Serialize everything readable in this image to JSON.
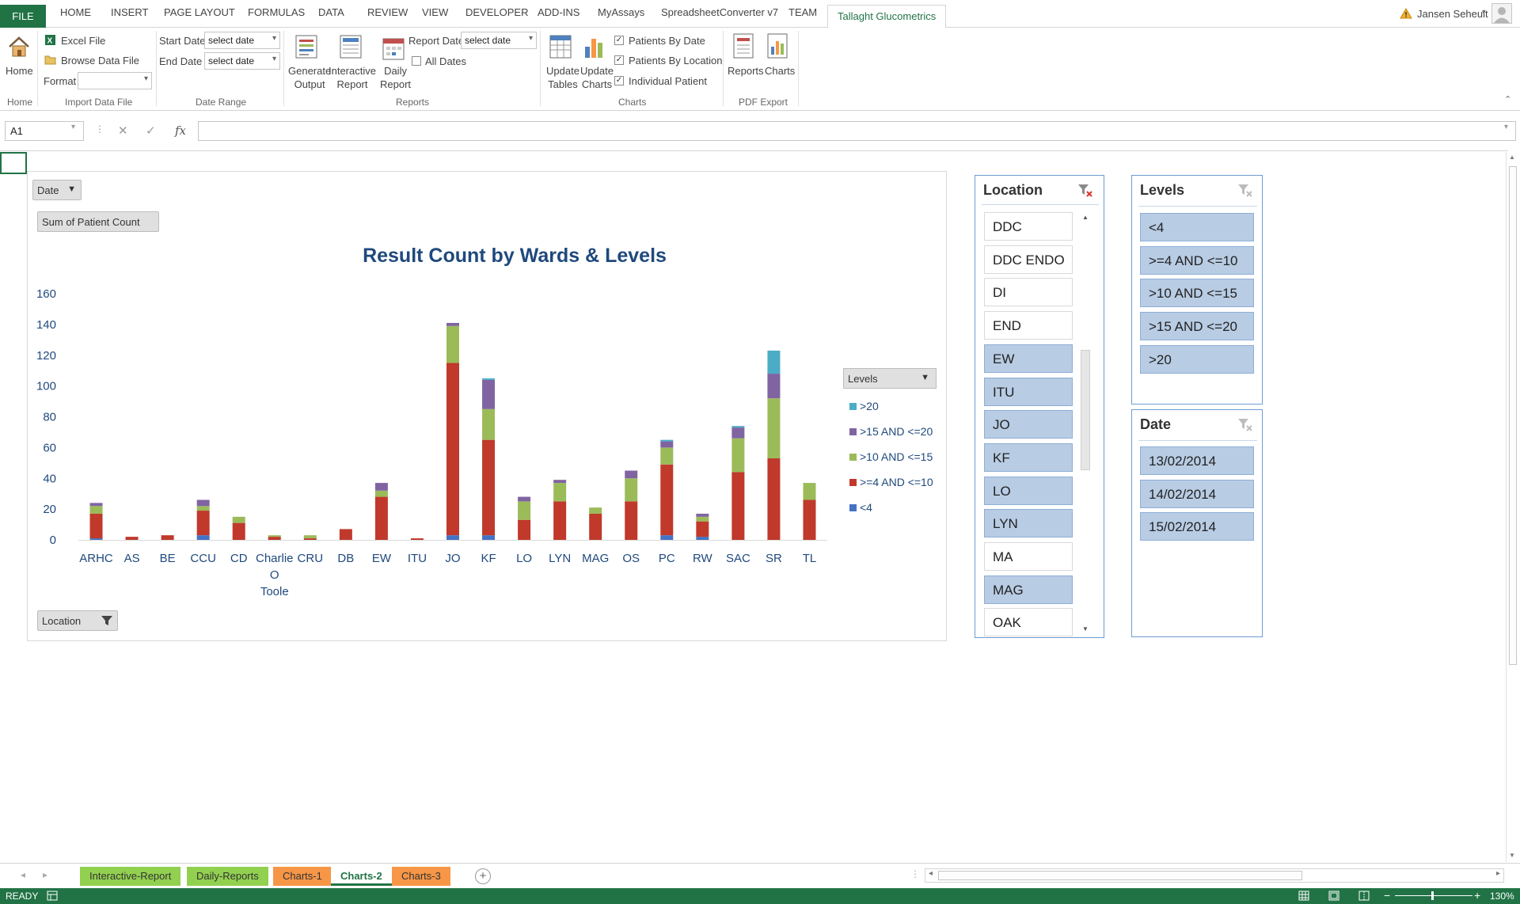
{
  "ribbon_tabs": [
    "FILE",
    "HOME",
    "INSERT",
    "PAGE LAYOUT",
    "FORMULAS",
    "DATA",
    "REVIEW",
    "VIEW",
    "DEVELOPER",
    "ADD-INS",
    "MyAssays",
    "SpreadsheetConverter v7",
    "TEAM",
    "Tallaght Glucometrics"
  ],
  "user": {
    "name": "Jansen Seheult"
  },
  "ribbon": {
    "home_label": "Home",
    "excel_file": "Excel File",
    "browse_data_file": "Browse Data File",
    "format_label": "Format",
    "format_value": "",
    "start_date_label": "Start Date",
    "start_date_value": "select date",
    "end_date_label": "End Date",
    "end_date_value": "select date",
    "generate_output": [
      "Generate",
      "Output"
    ],
    "interactive_report": [
      "Interactive",
      "Report"
    ],
    "daily_report": [
      "Daily",
      "Report"
    ],
    "report_date_label": "Report Date",
    "report_date_value": "select date",
    "all_dates": "All Dates",
    "update_tables": [
      "Update",
      "Tables"
    ],
    "update_charts": [
      "Update",
      "Charts"
    ],
    "patients_by_date": "Patients By Date",
    "patients_by_location": "Patients By Location",
    "individual_patient": "Individual Patient",
    "reports": "Reports",
    "charts": "Charts",
    "groups": {
      "home": "Home",
      "import": "Import Data File",
      "date_range": "Date Range",
      "reports": "Reports",
      "charts": "Charts",
      "pdf_export": "PDF Export"
    },
    "checks": {
      "patients_by_date": true,
      "patients_by_location": true,
      "individual_patient": true,
      "all_dates": false
    }
  },
  "formula_bar": {
    "name_box": "A1",
    "formula": ""
  },
  "pivot": {
    "date_button": "Date",
    "sum_button": "Sum of Patient Count",
    "location_button": "Location",
    "levels_button": "Levels"
  },
  "chart_data": {
    "type": "bar",
    "stacked": true,
    "title": "Result Count by Wards & Levels",
    "categories": [
      "ARHC",
      "AS",
      "BE",
      "CCU",
      "CD",
      "Charlie O Toole",
      "CRU",
      "DB",
      "EW",
      "ITU",
      "JO",
      "KF",
      "LO",
      "LYN",
      "MAG",
      "OS",
      "PC",
      "RW",
      "SAC",
      "SR",
      "TL"
    ],
    "category_lines": [
      [
        "ARHC"
      ],
      [
        "AS"
      ],
      [
        "BE"
      ],
      [
        "CCU"
      ],
      [
        "CD"
      ],
      [
        "Charlie",
        "O",
        "Toole"
      ],
      [
        "CRU"
      ],
      [
        "DB"
      ],
      [
        "EW"
      ],
      [
        "ITU"
      ],
      [
        "JO"
      ],
      [
        "KF"
      ],
      [
        "LO"
      ],
      [
        "LYN"
      ],
      [
        "MAG"
      ],
      [
        "OS"
      ],
      [
        "PC"
      ],
      [
        "RW"
      ],
      [
        "SAC"
      ],
      [
        "SR"
      ],
      [
        "TL"
      ]
    ],
    "series": [
      {
        "name": "<4",
        "color": "#4472c4",
        "values": [
          1,
          0,
          0,
          3,
          0,
          0,
          0,
          0,
          0,
          0,
          3,
          3,
          0,
          0,
          0,
          0,
          3,
          2,
          0,
          0,
          0
        ]
      },
      {
        "name": ">=4 AND <=10",
        "color": "#c0392b",
        "values": [
          16,
          2,
          3,
          16,
          11,
          2,
          1,
          7,
          28,
          1,
          112,
          62,
          13,
          25,
          17,
          25,
          46,
          10,
          44,
          53,
          26
        ]
      },
      {
        "name": ">10 AND <=15",
        "color": "#9bbb59",
        "values": [
          5,
          0,
          0,
          3,
          4,
          1,
          2,
          0,
          4,
          0,
          24,
          20,
          12,
          12,
          4,
          15,
          11,
          3,
          22,
          39,
          11
        ]
      },
      {
        "name": ">15 AND <=20",
        "color": "#8064a2",
        "values": [
          2,
          0,
          0,
          4,
          0,
          0,
          0,
          0,
          5,
          0,
          2,
          19,
          3,
          2,
          0,
          5,
          4,
          2,
          7,
          16,
          0
        ]
      },
      {
        "name": ">20",
        "color": "#4bacc6",
        "values": [
          0,
          0,
          0,
          0,
          0,
          0,
          0,
          0,
          0,
          0,
          0,
          1,
          0,
          0,
          0,
          0,
          1,
          0,
          1,
          15,
          0
        ]
      }
    ],
    "yticks": [
      0,
      20,
      40,
      60,
      80,
      100,
      120,
      140,
      160
    ],
    "ylim": [
      0,
      160
    ],
    "grid": false,
    "legend": "right"
  },
  "slicers": {
    "location": {
      "title": "Location",
      "items": [
        {
          "label": "DDC",
          "selected": false
        },
        {
          "label": "DDC ENDO",
          "selected": false
        },
        {
          "label": "DI",
          "selected": false
        },
        {
          "label": "END",
          "selected": false
        },
        {
          "label": "EW",
          "selected": true
        },
        {
          "label": "ITU",
          "selected": true
        },
        {
          "label": "JO",
          "selected": true
        },
        {
          "label": "KF",
          "selected": true
        },
        {
          "label": "LO",
          "selected": true
        },
        {
          "label": "LYN",
          "selected": true
        },
        {
          "label": "MA",
          "selected": false
        },
        {
          "label": "MAG",
          "selected": true
        },
        {
          "label": "OAK",
          "selected": false
        }
      ]
    },
    "levels": {
      "title": "Levels",
      "items": [
        "<4",
        ">=4 AND <=10",
        ">10 AND <=15",
        ">15 AND <=20",
        ">20"
      ]
    },
    "date": {
      "title": "Date",
      "items": [
        "13/02/2014",
        "14/02/2014",
        "15/02/2014"
      ]
    }
  },
  "sheet_tabs": [
    {
      "label": "Interactive-Report",
      "color": "#92d050",
      "active": false
    },
    {
      "label": "Daily-Reports",
      "color": "#92d050",
      "active": false
    },
    {
      "label": "Charts-1",
      "color": "#f79646",
      "active": false
    },
    {
      "label": "Charts-2",
      "color": "#ffffff",
      "active": true
    },
    {
      "label": "Charts-3",
      "color": "#f79646",
      "active": false
    }
  ],
  "status": {
    "mode": "READY",
    "zoom": "130%"
  },
  "colors": {
    "accent": "#217346",
    "title": "#1f497d",
    "slicer_on": "#b8cce4"
  }
}
